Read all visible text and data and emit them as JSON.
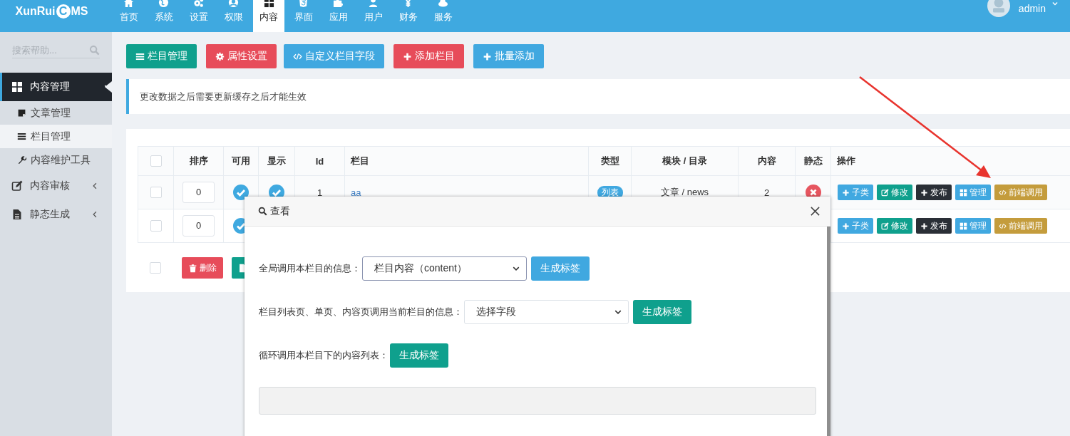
{
  "logo": {
    "before": "XunRui",
    "mark": "C",
    "after": "MS"
  },
  "nav": [
    {
      "label": "首页",
      "kind": "home",
      "selected": false
    },
    {
      "label": "系统",
      "kind": "globe",
      "selected": false
    },
    {
      "label": "设置",
      "kind": "gears",
      "selected": false
    },
    {
      "label": "权限",
      "kind": "user",
      "selected": false
    },
    {
      "label": "内容",
      "kind": "grid",
      "selected": true
    },
    {
      "label": "界面",
      "kind": "shield",
      "selected": false
    },
    {
      "label": "应用",
      "kind": "puzzle",
      "selected": false
    },
    {
      "label": "用户",
      "kind": "person",
      "selected": false
    },
    {
      "label": "财务",
      "kind": "yen",
      "selected": false
    },
    {
      "label": "服务",
      "kind": "cloud",
      "selected": false
    }
  ],
  "user": {
    "name": "admin"
  },
  "sidebar": {
    "search_placeholder": "搜索帮助...",
    "items": [
      {
        "label": "内容管理",
        "kind": "grid",
        "expanded": true,
        "selected": true,
        "children": [
          {
            "label": "文章管理",
            "kind": "note",
            "selected": false
          },
          {
            "label": "栏目管理",
            "kind": "bars",
            "selected": true
          },
          {
            "label": "内容维护工具",
            "kind": "wrench",
            "selected": false
          }
        ]
      },
      {
        "label": "内容审核",
        "kind": "edit",
        "expanded": false,
        "selected": false
      },
      {
        "label": "静态生成",
        "kind": "file",
        "expanded": false,
        "selected": false
      }
    ]
  },
  "toolbar": [
    {
      "label": "栏目管理",
      "kind": "bars",
      "color": "#0fa08d"
    },
    {
      "label": "属性设置",
      "kind": "gear",
      "color": "#e74c5a"
    },
    {
      "label": "自定义栏目字段",
      "kind": "code",
      "color": "#40a8e0"
    },
    {
      "label": "添加栏目",
      "kind": "plus",
      "color": "#e74c5a"
    },
    {
      "label": "批量添加",
      "kind": "plus",
      "color": "#40a8e0"
    }
  ],
  "notice": "更改数据之后需要更新缓存之后才能生效",
  "table": {
    "all_checked": false,
    "columns": [
      "排序",
      "可用",
      "显示",
      "Id",
      "栏目",
      "类型",
      "模块 / 目录",
      "内容",
      "静态",
      "操作"
    ],
    "rows": [
      {
        "checked": false,
        "order": "0",
        "enabled": true,
        "visible": true,
        "id": "1",
        "name": "aa",
        "type": "列表",
        "module": "文章 / news",
        "count": "2",
        "static": false,
        "actions": [
          {
            "label": "子类",
            "kind": "plus",
            "color": "#40a8e0"
          },
          {
            "label": "修改",
            "kind": "edit",
            "color": "#0fa08d"
          },
          {
            "label": "发布",
            "kind": "plus",
            "color": "#2a2f36"
          },
          {
            "label": "管理",
            "kind": "grid",
            "color": "#40a8e0"
          },
          {
            "label": "前端调用",
            "kind": "code",
            "color": "#c49c3c"
          }
        ]
      },
      {
        "checked": false,
        "order": "0",
        "enabled": true,
        "actions": [
          {
            "label": "子类",
            "kind": "plus",
            "color": "#40a8e0"
          },
          {
            "label": "修改",
            "kind": "edit",
            "color": "#0fa08d"
          },
          {
            "label": "发布",
            "kind": "plus",
            "color": "#2a2f36"
          },
          {
            "label": "管理",
            "kind": "grid",
            "color": "#40a8e0"
          },
          {
            "label": "前端调用",
            "kind": "code",
            "color": "#c49c3c"
          }
        ]
      }
    ]
  },
  "footer": {
    "checked": false,
    "buttons": [
      {
        "label": "删除",
        "kind": "trash",
        "color": "#e74c5a"
      },
      {
        "kind": "file",
        "color": "#0fa08d"
      }
    ]
  },
  "modal": {
    "title": "查看",
    "rows": [
      {
        "label": "全局调用本栏目的信息：",
        "select": "栏目内容（content）",
        "focused": true,
        "button": "生成标签",
        "color": "#40a8e0"
      },
      {
        "label": "栏目列表页、单页、内容页调用当前栏目的信息：",
        "select": "选择字段",
        "focused": false,
        "button": "生成标签",
        "color": "#0fa08d"
      },
      {
        "label": "循环调用本栏目下的内容列表：",
        "button": "生成标签",
        "color": "#0fa08d"
      }
    ]
  }
}
